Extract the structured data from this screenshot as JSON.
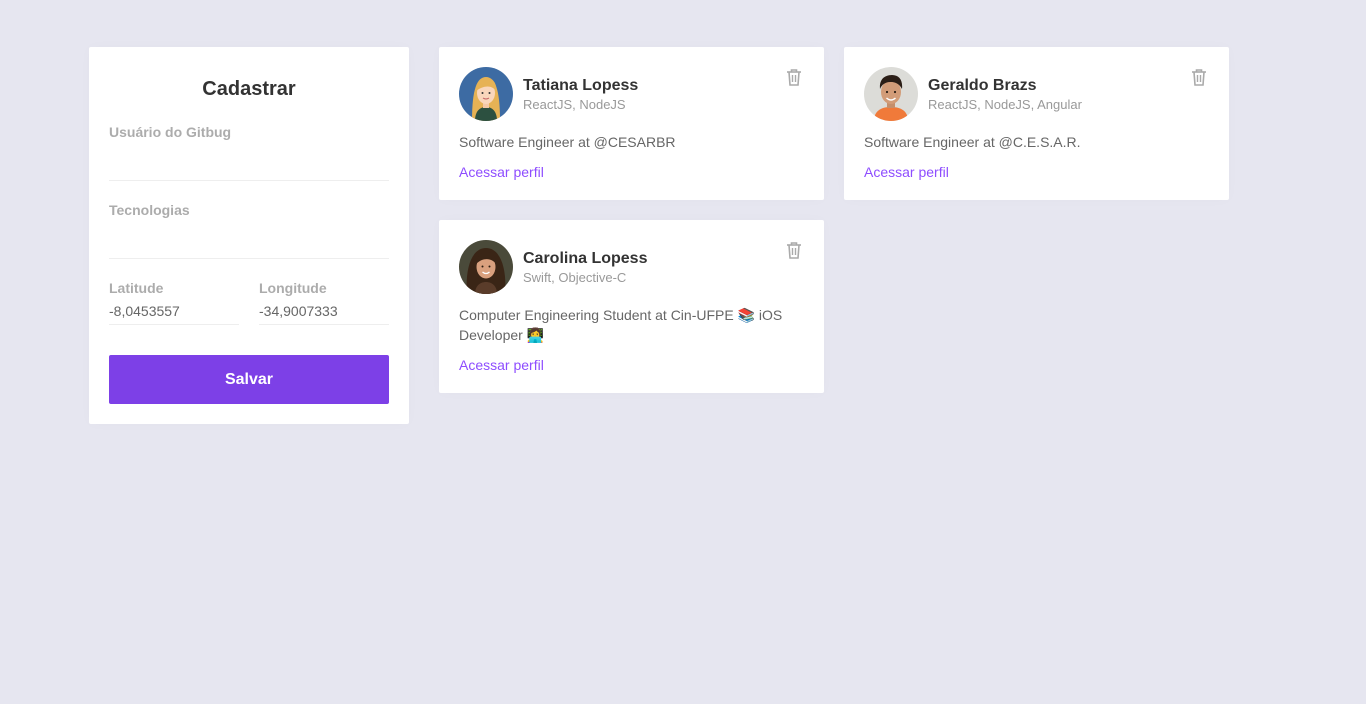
{
  "form": {
    "title": "Cadastrar",
    "github_user": {
      "label": "Usuário do Gitbug",
      "value": ""
    },
    "techs": {
      "label": "Tecnologias",
      "value": ""
    },
    "latitude": {
      "label": "Latitude",
      "value": "-8,0453557"
    },
    "longitude": {
      "label": "Longitude",
      "value": "-34,9007333"
    },
    "save_label": "Salvar"
  },
  "devs": [
    {
      "name": "Tatiana Lopess",
      "techs": "ReactJS, NodeJS",
      "bio": "Software Engineer at @CESARBR",
      "link_label": "Acessar perfil",
      "avatar": "avatar-illustration-woman"
    },
    {
      "name": "Geraldo Brazs",
      "techs": "ReactJS, NodeJS, Angular",
      "bio": "Software Engineer at @C.E.S.A.R.",
      "link_label": "Acessar perfil",
      "avatar": "avatar-photo-man"
    },
    {
      "name": "Carolina Lopess",
      "techs": "Swift, Objective-C",
      "bio": "Computer Engineering Student at Cin-UFPE 📚 iOS Developer 👩‍💻",
      "link_label": "Acessar perfil",
      "avatar": "avatar-photo-woman"
    }
  ],
  "icons": {
    "delete": "trash-icon"
  },
  "colors": {
    "background": "#e6e6f0",
    "accent": "#7d40e7",
    "link": "#8e4dff"
  }
}
